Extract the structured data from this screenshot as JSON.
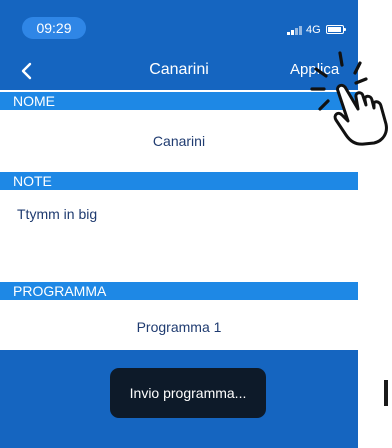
{
  "status_bar": {
    "time": "09:29",
    "network": "4G",
    "icons": [
      "signal-icon",
      "battery-icon"
    ]
  },
  "nav": {
    "title": "Canarini",
    "back_icon": "chevron-left-icon",
    "apply_label": "Applica"
  },
  "sections": {
    "nome": {
      "label": "NOME",
      "value": "Canarini"
    },
    "note": {
      "label": "NOTE",
      "value": "Ttymm in big"
    },
    "programma": {
      "label": "PROGRAMMA",
      "value": "Programma 1"
    }
  },
  "toast": {
    "message": "Invio programma..."
  },
  "overlay": {
    "gesture_icon": "tap-hand-icon"
  },
  "colors": {
    "header_bg": "#1565c0",
    "section_bg": "#1e88e5",
    "text": "#1f3b70",
    "toast_bg": "#0d1a29"
  }
}
